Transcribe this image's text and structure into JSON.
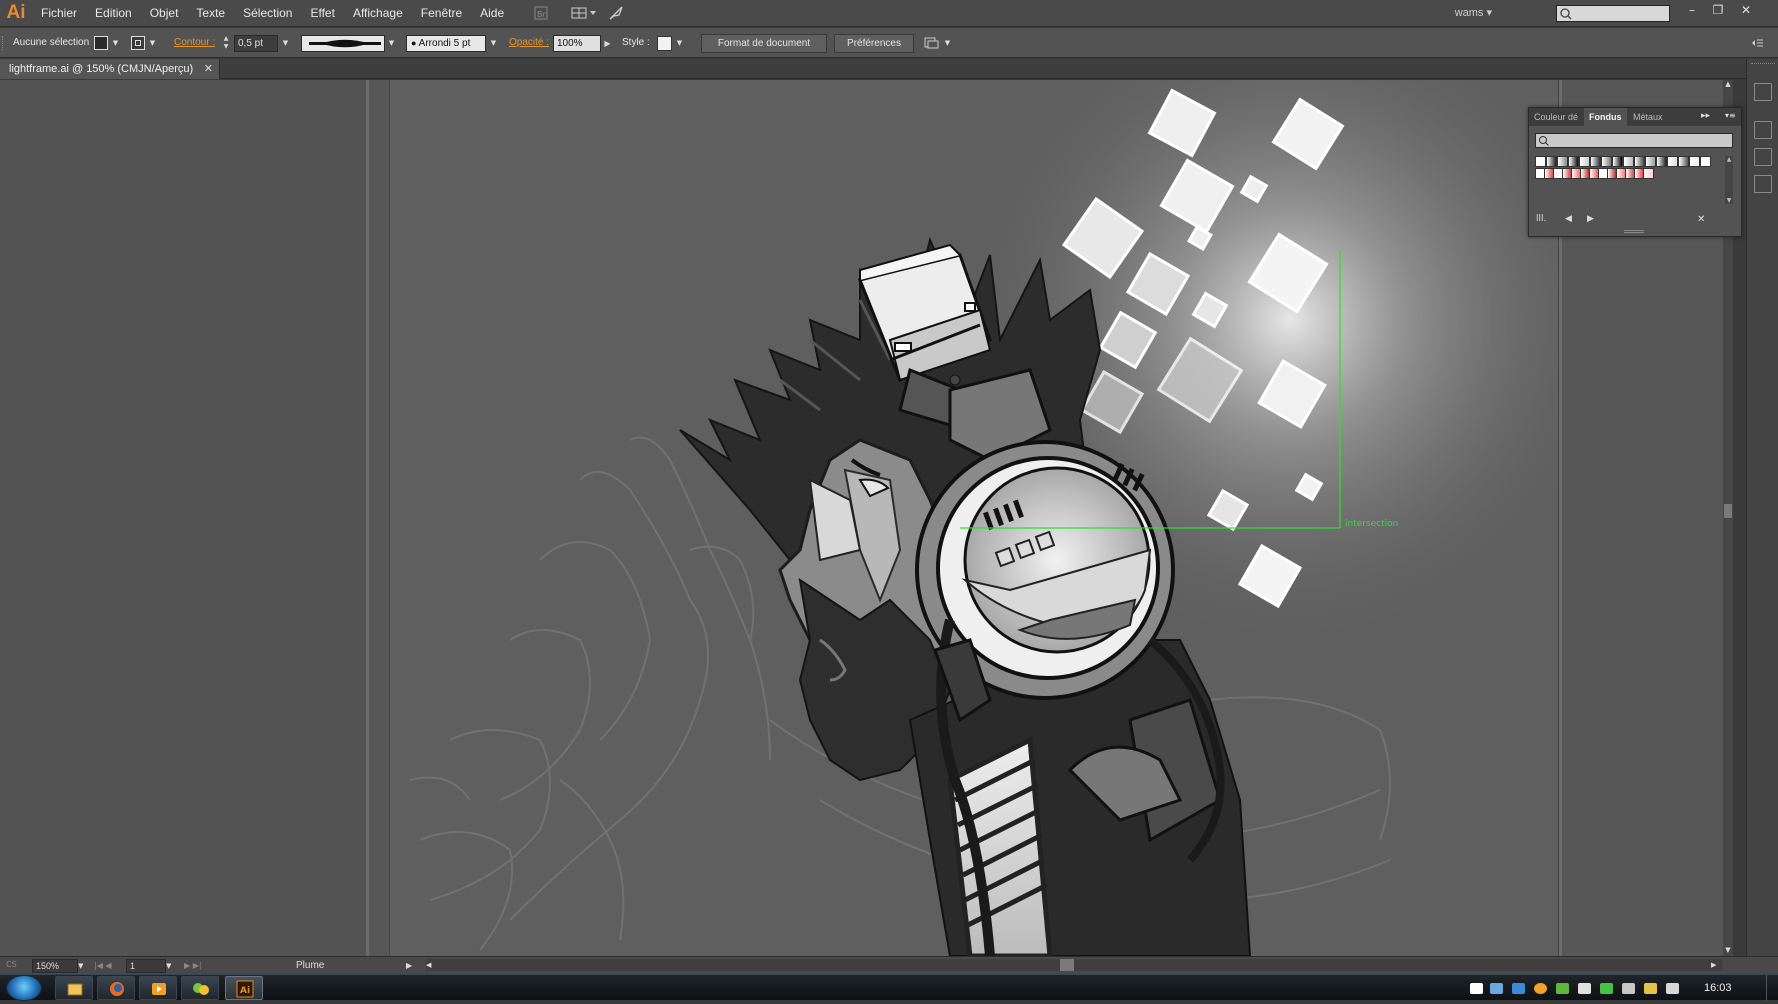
{
  "app": {
    "logo_text": "Ai",
    "menu": [
      "Fichier",
      "Edition",
      "Objet",
      "Texte",
      "Sélection",
      "Effet",
      "Affichage",
      "Fenêtre",
      "Aide"
    ],
    "user_label": "wams",
    "accent_color": "#e58a2e"
  },
  "control_bar": {
    "selection_label": "Aucune sélection",
    "stroke_label": "Contour :",
    "stroke_weight": "0,5 pt",
    "brush_label": "Arrondi 5 pt",
    "opacity_label": "Opacité :",
    "opacity_value": "100%",
    "style_label": "Style :",
    "document_setup_button": "Format de document",
    "preferences_button": "Préférences"
  },
  "document_tab": {
    "title": "lightframe.ai @ 150% (CMJN/Aperçu)"
  },
  "swatch_panel": {
    "tabs": [
      "Couleur dé",
      "Fondus",
      "Métaux"
    ],
    "active_tab": "Fondus"
  },
  "canvas": {
    "smart_guide_label": "intersection"
  },
  "status_bar": {
    "zoom": "150%",
    "artboard_number": "1",
    "current_tool": "Plume"
  },
  "taskbar": {
    "clock": "16:03"
  }
}
